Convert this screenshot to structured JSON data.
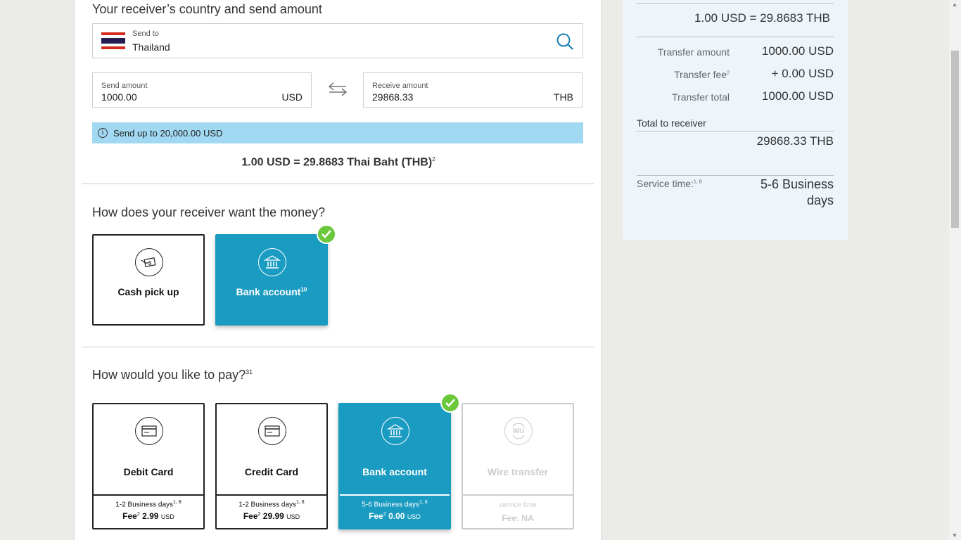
{
  "receiver": {
    "section_title": "Your receiver’s country and send amount",
    "send_to_label": "Send to",
    "send_to_value": "Thailand",
    "send_amount_label": "Send amount",
    "send_amount_value": "1000.00",
    "send_currency": "USD",
    "receive_amount_label": "Receive amount",
    "receive_amount_value": "29868.33",
    "receive_currency": "THB",
    "info_text": "Send up to 20,000.00 USD",
    "rate_text": "1.00 USD = 29.8683 Thai Baht (THB)",
    "rate_sup": "2"
  },
  "delivery": {
    "title": "How does your receiver want the money?",
    "options": [
      {
        "label": "Cash pick up",
        "sup": "",
        "icon": "cash-hand-icon",
        "selected": false
      },
      {
        "label": "Bank account",
        "sup": "10",
        "icon": "bank-icon",
        "selected": true
      }
    ]
  },
  "payment": {
    "title": "How would you like to pay?",
    "title_sup": "31",
    "options": [
      {
        "label": "Debit Card",
        "days": "1-2  Business days",
        "days_sup": "1, 8",
        "fee_label": "Fee",
        "fee_sup": "2",
        "fee_value": "2.99",
        "fee_cur": "USD",
        "icon": "card-icon"
      },
      {
        "label": "Credit Card",
        "days": "1-2  Business days",
        "days_sup": "1, 8",
        "fee_label": "Fee",
        "fee_sup": "2",
        "fee_value": "29.99",
        "fee_cur": "USD",
        "icon": "card-icon"
      },
      {
        "label": "Bank account",
        "days": "5-6  Business days",
        "days_sup": "1, 8",
        "fee_label": "Fee",
        "fee_sup": "2",
        "fee_value": "0.00",
        "fee_cur": "USD",
        "icon": "bank-icon"
      },
      {
        "label": "Wire transfer",
        "days": "service time",
        "fee_text": "Fee: NA",
        "icon": "wire-transfer-icon"
      }
    ]
  },
  "summary": {
    "rate": "1.00 USD = 29.8683 THB",
    "transfer_amount_label": "Transfer amount",
    "transfer_amount_value": "1000.00  USD",
    "transfer_fee_label": "Transfer fee",
    "transfer_fee_sup": "2",
    "transfer_fee_value": "+ 0.00  USD",
    "transfer_total_label": "Transfer total",
    "transfer_total_value": "1000.00  USD",
    "total_receiver_label": "Total to receiver",
    "total_receiver_value": "29868.33 THB",
    "service_time_label": "Service time:",
    "service_time_sup": "1, 8",
    "service_time_value_1": "5-6 Business",
    "service_time_value_2": "days"
  },
  "colors": {
    "accent": "#1a9bc1",
    "check": "#6bc83a",
    "info": "#a1d9f2"
  }
}
